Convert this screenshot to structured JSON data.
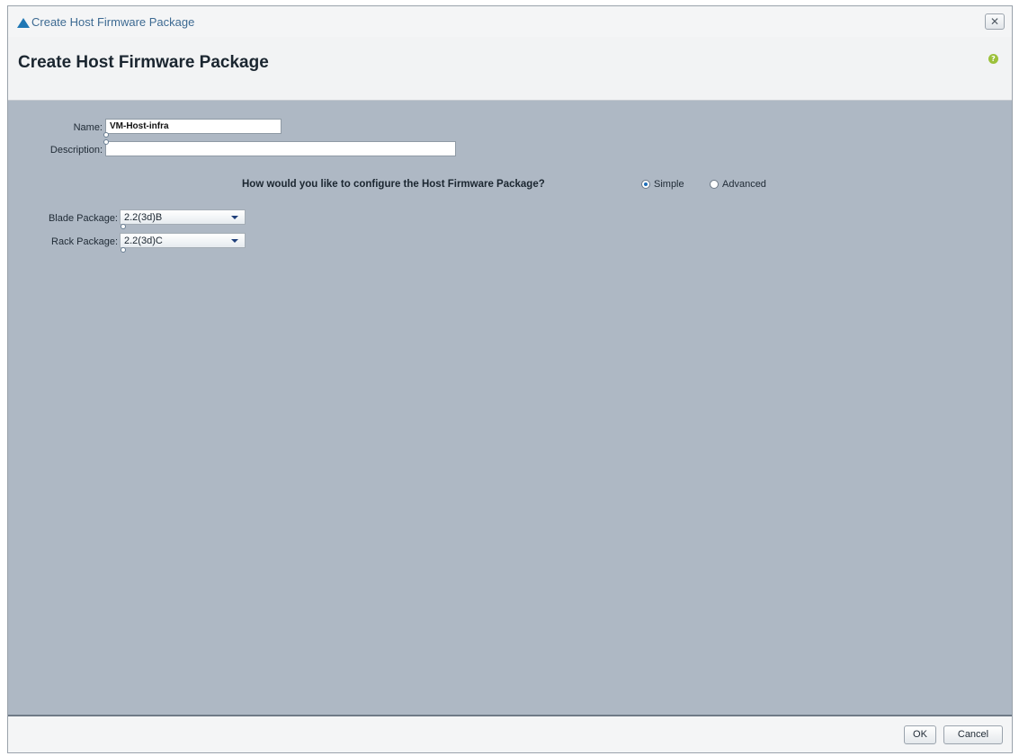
{
  "window": {
    "title": "Create Host Firmware Package",
    "close_glyph": "✕"
  },
  "header": {
    "title": "Create Host Firmware Package",
    "help_glyph": "?"
  },
  "form": {
    "name_label": "Name:",
    "name_value": "VM-Host-infra",
    "description_label": "Description:",
    "description_value": "",
    "configure_question": "How would you like to configure the Host Firmware Package?",
    "mode_options": [
      "Simple",
      "Advanced"
    ],
    "mode_selected": "Simple",
    "blade_package_label": "Blade Package:",
    "blade_package_value": "2.2(3d)B",
    "rack_package_label": "Rack Package:",
    "rack_package_value": "2.2(3d)C"
  },
  "footer": {
    "ok_label": "OK",
    "cancel_label": "Cancel"
  },
  "colors": {
    "content_bg": "#aeb8c4",
    "accent": "#1f77b4",
    "help": "#9cc13b"
  }
}
